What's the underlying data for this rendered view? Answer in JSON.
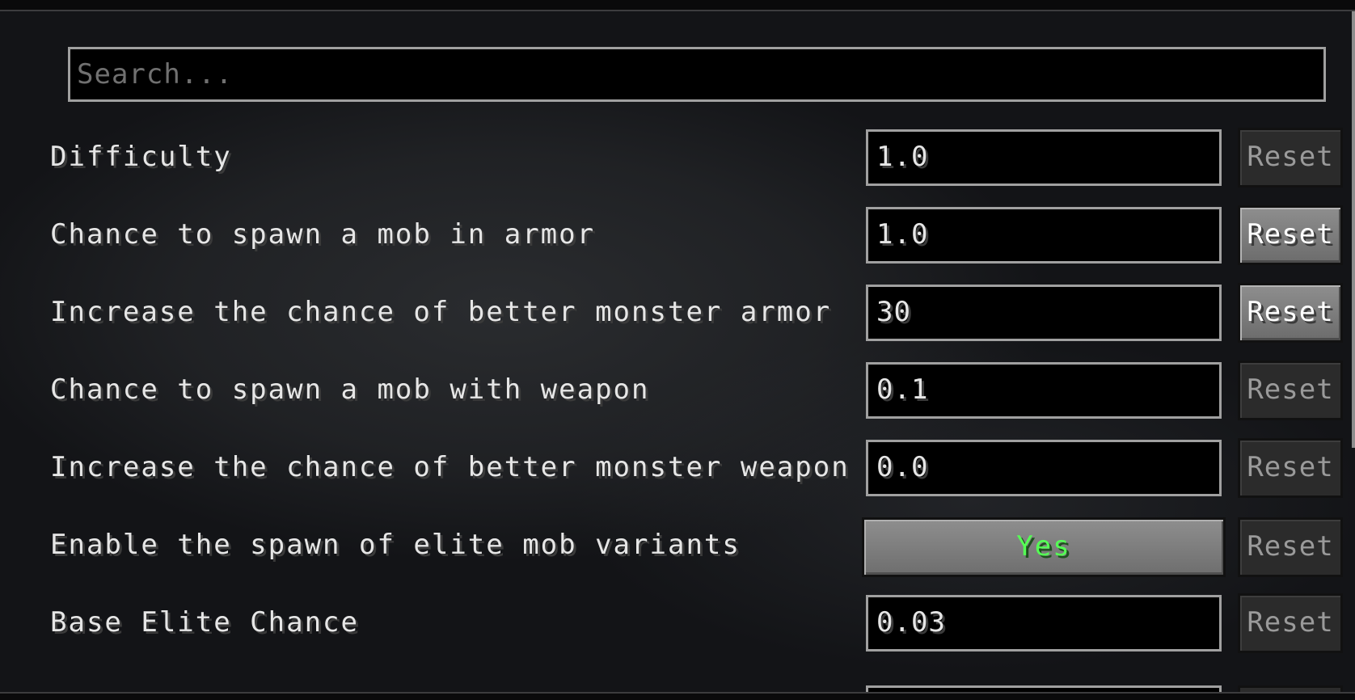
{
  "search": {
    "placeholder": "Search..."
  },
  "settings": [
    {
      "label": "Difficulty",
      "value": "1.0",
      "type": "text",
      "reset_label": "Reset",
      "reset_enabled": false
    },
    {
      "label": "Chance to spawn a mob in armor",
      "value": "1.0",
      "type": "text",
      "reset_label": "Reset",
      "reset_enabled": true
    },
    {
      "label": "Increase the chance of better monster armor",
      "value": "30",
      "type": "text",
      "reset_label": "Reset",
      "reset_enabled": true
    },
    {
      "label": "Chance to spawn a mob with weapon",
      "value": "0.1",
      "type": "text",
      "reset_label": "Reset",
      "reset_enabled": false
    },
    {
      "label": "Increase the chance of better monster weapon",
      "value": "0.0",
      "type": "text",
      "reset_label": "Reset",
      "reset_enabled": false
    },
    {
      "label": "Enable the spawn of elite mob variants",
      "value": "Yes",
      "type": "toggle",
      "reset_label": "Reset",
      "reset_enabled": false
    },
    {
      "label": "Base Elite Chance",
      "value": "0.03",
      "type": "text",
      "reset_label": "Reset",
      "reset_enabled": false
    }
  ],
  "colors": {
    "toggle_on_text": "#55ff55",
    "label_text": "#e6e6e6",
    "reset_disabled_text": "#9a9a9a",
    "reset_enabled_text": "#ffffff"
  }
}
